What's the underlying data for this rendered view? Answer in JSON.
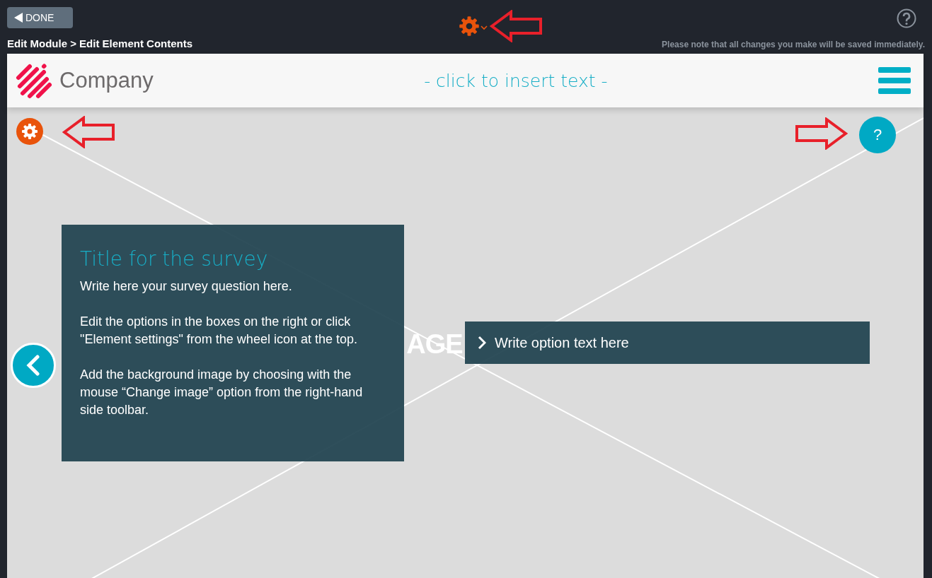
{
  "top_bar": {
    "done_button": "DONE",
    "breadcrumb": "Edit Module > Edit Element Contents",
    "notice": "Please note that all changes you make will be saved immediately."
  },
  "header": {
    "company": "Company",
    "insert_text": "- click to insert text -"
  },
  "stage": {
    "placeholder": "AGE",
    "help_button": "?",
    "survey": {
      "title": "Title for the survey",
      "paragraphs": [
        "Write here your survey question here.",
        "Edit the options in the boxes on the right or click \"Element settings\" from the wheel icon at the top.",
        "Add the background image by choosing with the mouse “Change image” option from the right-hand side toolbar."
      ]
    },
    "options": [
      {
        "label": "Write option text here"
      }
    ]
  }
}
